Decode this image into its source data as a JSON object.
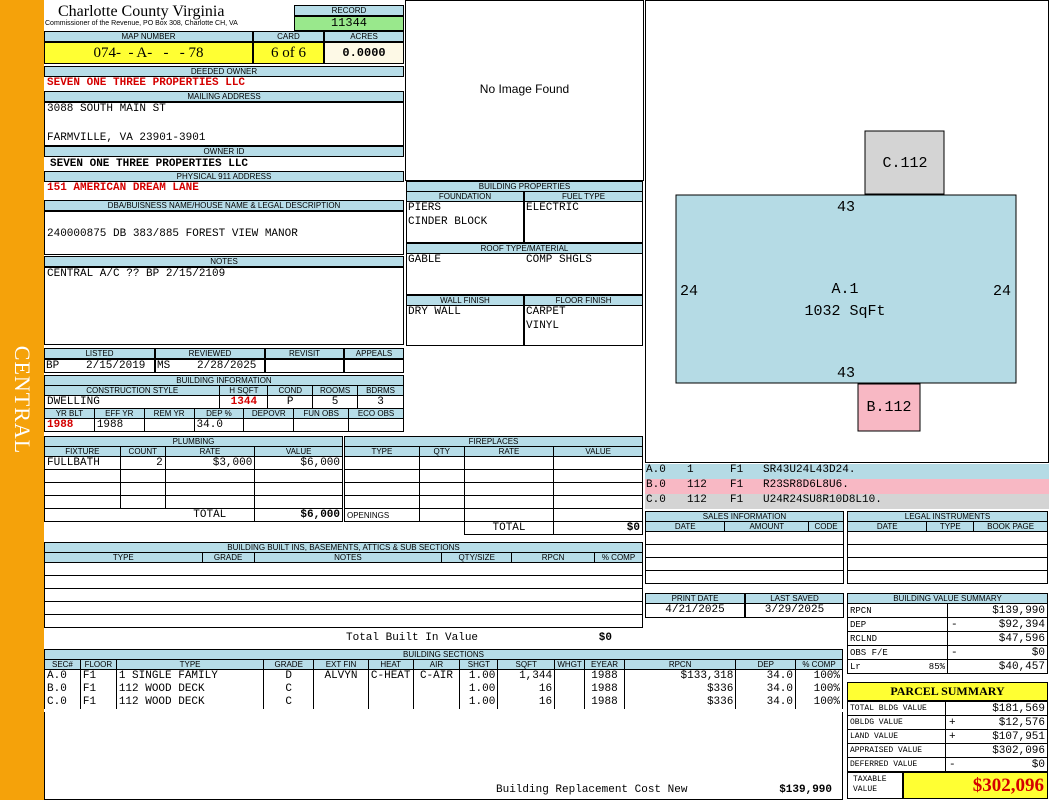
{
  "sidebar_label": "CENTRAL",
  "county": "Charlotte County Virginia",
  "commissioner": "Commissioner of the Revenue, PO Box 308, Charlotte CH, VA",
  "record": {
    "label": "RECORD",
    "value": "11344"
  },
  "map": {
    "label": "MAP NUMBER",
    "value": "074-  - A-   -   - 78"
  },
  "card": {
    "label": "CARD",
    "value": "6 of 6"
  },
  "acres": {
    "label": "ACRES",
    "value": "0.0000"
  },
  "deeded_owner": {
    "label": "DEEDED OWNER",
    "value": "SEVEN ONE THREE PROPERTIES LLC"
  },
  "mailing": {
    "label": "MAILING ADDRESS",
    "line1": "3088 SOUTH MAIN ST",
    "line2": "FARMVILLE, VA 23901-3901"
  },
  "owner_id": {
    "label": "OWNER ID",
    "value": "SEVEN ONE THREE PROPERTIES LLC"
  },
  "physical": {
    "label": "PHYSICAL 911 ADDRESS",
    "value": "151 AMERICAN DREAM LANE"
  },
  "dba": {
    "label": "DBA/BUISNESS NAME/HOUSE NAME & LEGAL DESCRIPTION",
    "value": "240000875 DB 383/885 FOREST VIEW MANOR"
  },
  "notes": {
    "label": "NOTES",
    "value": "CENTRAL A/C ?? BP 2/15/2109"
  },
  "image_text": "No Image Found",
  "bp": {
    "title": "BUILDING PROPERTIES",
    "foundation_label": "FOUNDATION",
    "fuel_label": "FUEL TYPE",
    "foundation1": "PIERS",
    "foundation2": "CINDER BLOCK",
    "fuel": "ELECTRIC",
    "roof_label": "ROOF TYPE/MATERIAL",
    "roof1": "GABLE",
    "roof2": "COMP SHGLS",
    "wall_label": "WALL FINISH",
    "floor_label": "FLOOR FINISH",
    "wall": "DRY WALL",
    "floor1": "CARPET",
    "floor2": "VINYL"
  },
  "listed": {
    "listed_label": "LISTED",
    "reviewed_label": "REVIEWED",
    "revisit_label": "REVISIT",
    "appeals_label": "APPEALS",
    "listed_by": "BP",
    "listed_date": "2/15/2019",
    "reviewed_by": "MS",
    "reviewed_date": "2/28/2025"
  },
  "bi": {
    "title": "BUILDING INFORMATION",
    "cs_label": "CONSTRUCTION STYLE",
    "hsqft_label": "H SQFT",
    "cond_label": "COND",
    "rooms_label": "ROOMS",
    "bdrms_label": "BDRMS",
    "cs": "DWELLING",
    "hsqft": "1344",
    "cond": "P",
    "rooms": "5",
    "bdrms": "3",
    "yrblt_label": "YR BLT",
    "effyr_label": "EFF YR",
    "remyr_label": "REM YR",
    "dep_label": "DEP %",
    "depovr_label": "DEPOVR",
    "funobs_label": "FUN OBS",
    "ecoobs_label": "ECO OBS",
    "yrblt": "1988",
    "effyr": "1988",
    "dep": "34.0"
  },
  "plumbing": {
    "title": "PLUMBING",
    "h1": "FIXTURE",
    "h2": "COUNT",
    "h3": "RATE",
    "h4": "VALUE",
    "fixture": "FULLBATH",
    "count": "2",
    "rate": "$3,000",
    "value": "$6,000",
    "total_label": "TOTAL",
    "total": "$6,000"
  },
  "fireplaces": {
    "title": "FIREPLACES",
    "h1": "TYPE",
    "h2": "QTY",
    "h3": "RATE",
    "h4": "VALUE",
    "openings_label": "OPENINGS",
    "total_label": "TOTAL",
    "total": "$0"
  },
  "builtins": {
    "title": "BUILDING BUILT INS, BASEMENTS, ATTICS & SUB SECTIONS",
    "h1": "TYPE",
    "h2": "GRADE",
    "h3": "NOTES",
    "h4": "QTY/SIZE",
    "h5": "RPCN",
    "h6": "% COMP",
    "total_label": "Total Built In Value",
    "total": "$0"
  },
  "sketch": {
    "c_label": "C.112",
    "a_label": "A.1",
    "a_area": "1032 SqFt",
    "b_label": "B.112",
    "top": "43",
    "bottom": "43",
    "left": "24",
    "right": "24"
  },
  "legend": [
    {
      "sec": "A.0",
      "num": "1",
      "flr": "F1",
      "code": "SR43U24L43D24.",
      "color": "#b5dbe5"
    },
    {
      "sec": "B.0",
      "num": "112",
      "flr": "F1",
      "code": "R23SR8D6L8U6.",
      "color": "#f8b8c4"
    },
    {
      "sec": "C.0",
      "num": "112",
      "flr": "F1",
      "code": "U24R24SU8R10D8L10.",
      "color": "#d4d4d4"
    }
  ],
  "sales": {
    "title": "SALES INFORMATION",
    "h1": "DATE",
    "h2": "AMOUNT",
    "h3": "CODE"
  },
  "legal": {
    "title": "LEGAL INSTRUMENTS",
    "h1": "DATE",
    "h2": "TYPE",
    "h3": "BOOK PAGE"
  },
  "print": {
    "pd_label": "PRINT DATE",
    "ls_label": "LAST SAVED",
    "pd": "4/21/2025",
    "ls": "3/29/2025"
  },
  "bvs": {
    "title": "BUILDING VALUE SUMMARY",
    "rpcn_label": "RPCN",
    "rpcn": "$139,990",
    "dep_label": "DEP",
    "dep_sign": "-",
    "dep": "$92,394",
    "rclnd_label": "RCLND",
    "rclnd": "$47,596",
    "obs_label": "OBS F/E",
    "obs_sign": "-",
    "obs": "$0",
    "lr_label": "Lr",
    "lr_pct": "85%",
    "lr": "$40,457"
  },
  "ps": {
    "title": "PARCEL SUMMARY",
    "tbv_label": "TOTAL BLDG VALUE",
    "tbv": "$181,569",
    "obv_label": "OBLDG VALUE",
    "obv_sign": "+",
    "obv": "$12,576",
    "lv_label": "LAND VALUE",
    "lv_sign": "+",
    "lv": "$107,951",
    "av_label": "APPRAISED VALUE",
    "av": "$302,096",
    "dv_label": "DEFERRED VALUE",
    "dv_sign": "-",
    "dv": "$0",
    "tv_label1": "TAXABLE",
    "tv_label2": "VALUE",
    "tv": "$302,096"
  },
  "sections": {
    "title": "BUILDING SECTIONS",
    "headers": [
      "SEC#",
      "FLOOR",
      "TYPE",
      "GRADE",
      "EXT FIN",
      "HEAT",
      "AIR",
      "SHGT",
      "SQFT",
      "WHGT",
      "EYEAR",
      "RPCN",
      "DEP",
      "% COMP"
    ],
    "rows": [
      [
        "A.0",
        "F1",
        "1 SINGLE FAMILY",
        "D",
        "ALVYN",
        "C-HEAT",
        "C-AIR",
        "1.00",
        "1,344",
        "",
        "1988",
        "$133,318",
        "34.0",
        "100%"
      ],
      [
        "B.0",
        "F1",
        "112 WOOD DECK",
        "C",
        "",
        "",
        "",
        "1.00",
        "16",
        "",
        "1988",
        "$336",
        "34.0",
        "100%"
      ],
      [
        "C.0",
        "F1",
        "112 WOOD DECK",
        "C",
        "",
        "",
        "",
        "1.00",
        "16",
        "",
        "1988",
        "$336",
        "34.0",
        "100%"
      ]
    ],
    "brcn_label": "Building Replacement Cost New",
    "brcn": "$139,990"
  }
}
